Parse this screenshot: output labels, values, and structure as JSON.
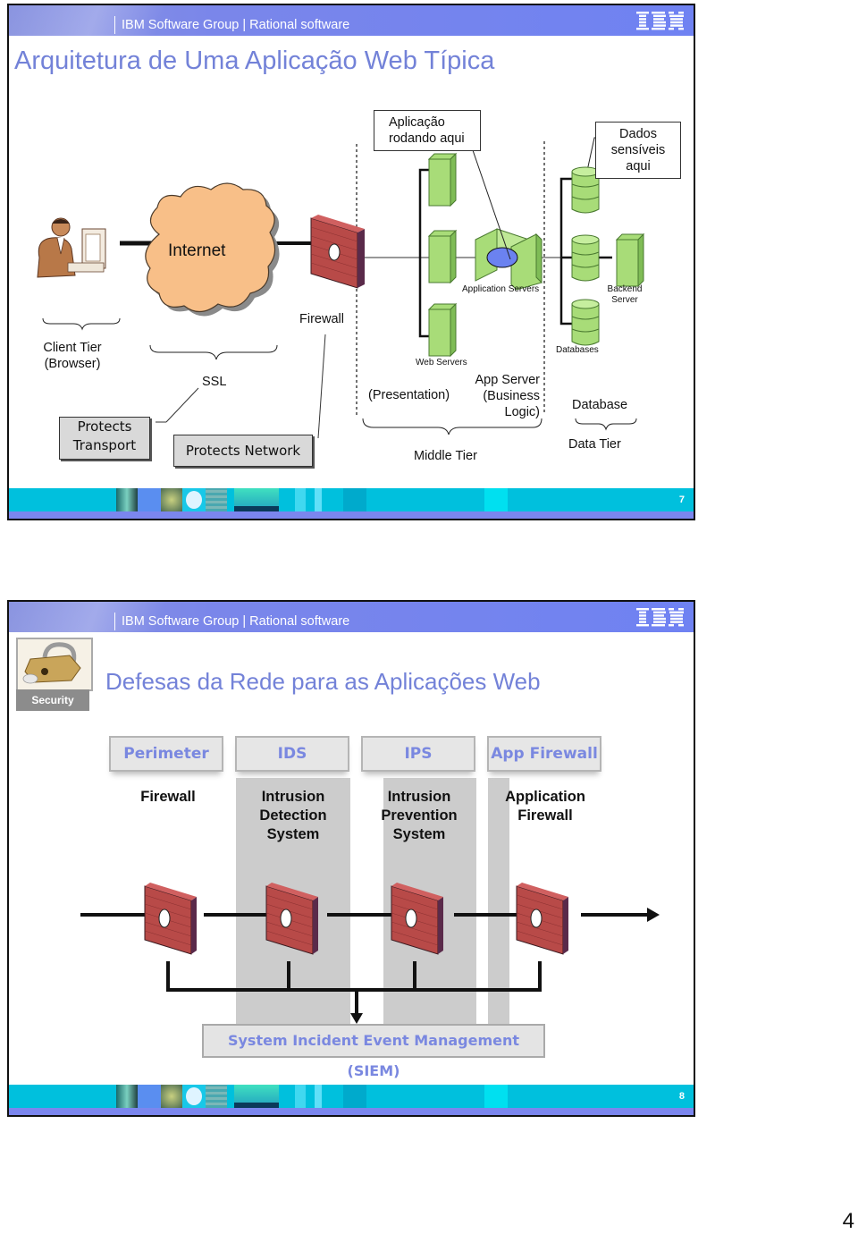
{
  "slides": [
    {
      "header": {
        "group": "IBM Software Group | Rational software",
        "logo": "IBM"
      },
      "title": "Arquitetura de Uma Aplicação Web Típica",
      "diagram": {
        "cloud_label": "Internet",
        "firewall_label": "Firewall",
        "client_tier": [
          "Client Tier",
          "(Browser)"
        ],
        "ssl_label": "SSL",
        "protects_transport": [
          "Protects",
          "Transport"
        ],
        "protects_network": "Protects Network",
        "callout_app": [
          "Aplicação",
          "rodando aqui"
        ],
        "callout_data": [
          "Dados",
          "sensíveis",
          "aqui"
        ],
        "web_servers_label": "Web Servers",
        "app_servers_label": "Application Servers",
        "databases_label": "Databases",
        "backend_server_label": [
          "Backend",
          "Server"
        ],
        "presentation_label": "(Presentation)",
        "app_server_label": [
          "App Server",
          "(Business",
          "Logic)"
        ],
        "database_label": "Database",
        "middle_tier_label": "Middle Tier",
        "data_tier_label": "Data Tier"
      },
      "footer": {
        "page": "7"
      }
    },
    {
      "header": {
        "group": "IBM Software Group | Rational software",
        "logo": "IBM"
      },
      "badge": "Security",
      "title": "Defesas da Rede para as Aplicações Web",
      "tabs": [
        {
          "label": "Perimeter",
          "desc": [
            "Firewall"
          ]
        },
        {
          "label": "IDS",
          "desc": [
            "Intrusion",
            "Detection",
            "System"
          ]
        },
        {
          "label": "IPS",
          "desc": [
            "Intrusion",
            "Prevention",
            "System"
          ]
        },
        {
          "label": "App Firewall",
          "desc": [
            "Application",
            "Firewall"
          ]
        }
      ],
      "siem_label": "System Incident Event Management (SIEM)",
      "footer": {
        "page": "8"
      }
    }
  ],
  "document_page": "4",
  "colors": {
    "title": "#7382d8",
    "header": "#7a86ea",
    "footer_teal": "#00c0dd",
    "footer_lilac": "#7b86ee",
    "firewall_brick": "#b84a48",
    "server_green": "#a8dc78",
    "cloud": "#f8bf88"
  }
}
